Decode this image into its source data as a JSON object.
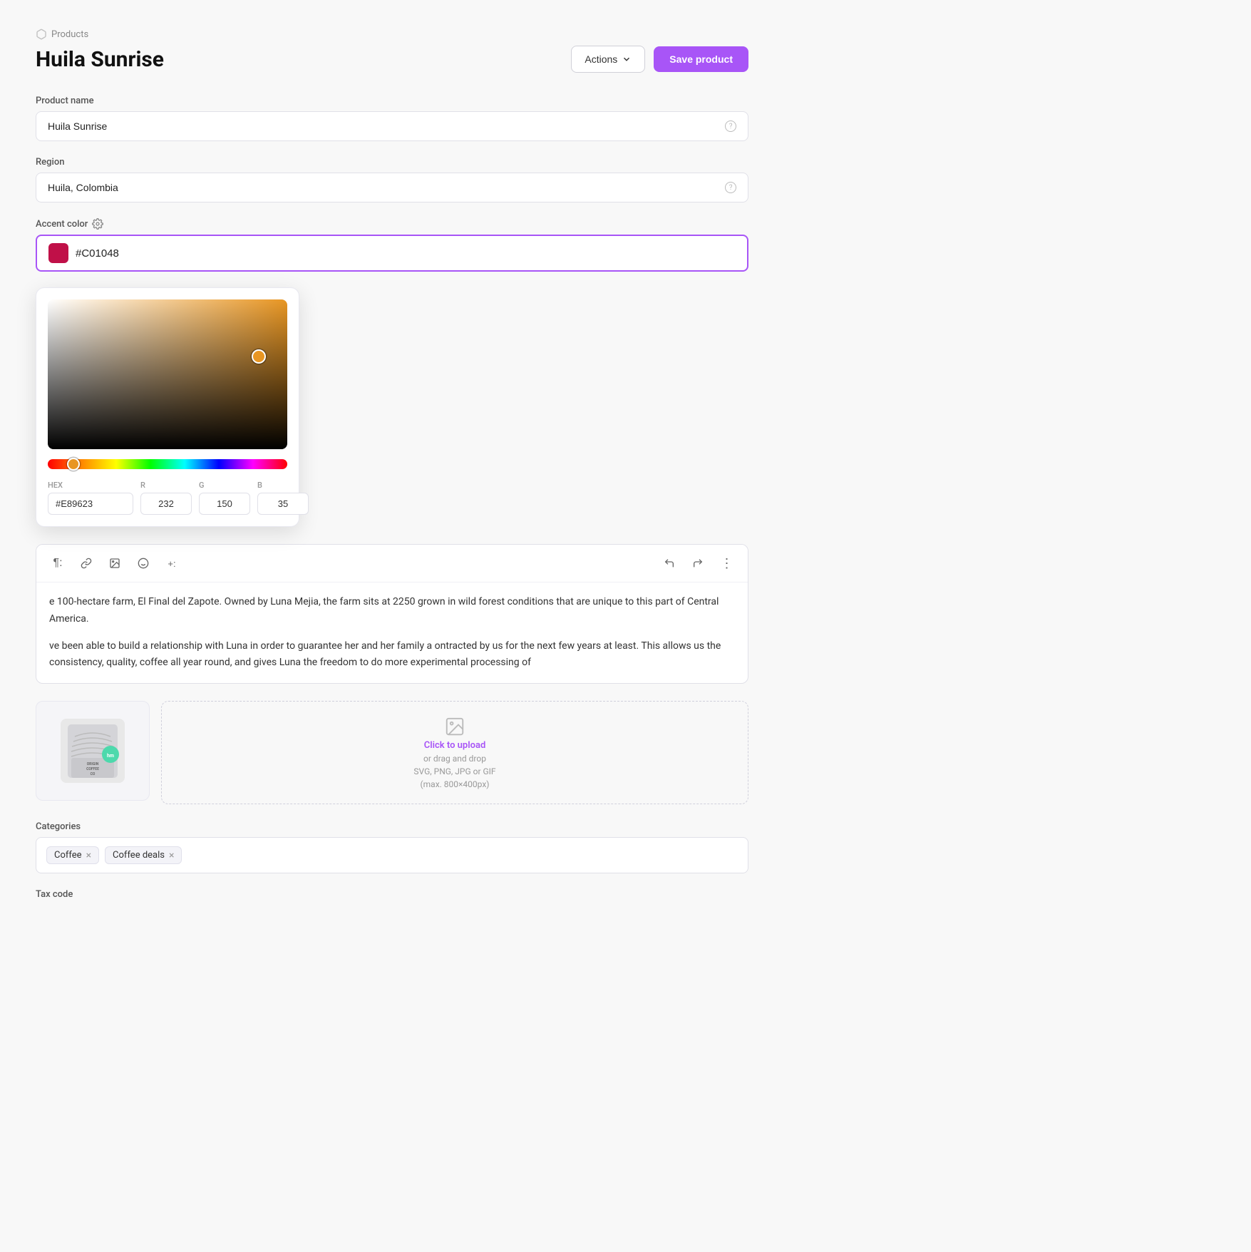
{
  "breadcrumb": {
    "icon": "cube",
    "label": "Products"
  },
  "page": {
    "title": "Huila Sunrise"
  },
  "header": {
    "actions_label": "Actions",
    "save_label": "Save product"
  },
  "form": {
    "product_name_label": "Product name",
    "product_name_value": "Huila Sunrise",
    "region_label": "Region",
    "region_value": "Huila, Colombia",
    "accent_color_label": "Accent color",
    "accent_color_value": "#C01048"
  },
  "color_picker": {
    "hex_label": "HEX",
    "hex_value": "#E89623",
    "r_label": "R",
    "r_value": "232",
    "g_label": "G",
    "g_value": "150",
    "b_label": "B",
    "b_value": "35"
  },
  "editor": {
    "content_1": "e 100-hectare farm, El Final del Zapote. Owned by Luna Mejia, the farm sits at 2250 grown in wild forest conditions that are unique to this part of Central America.",
    "content_2": "ve been able to build a relationship with Luna in order to guarantee her and her family a ontracted by us for the next few years at least. This allows us the consistency, quality, coffee all year round, and gives Luna the freedom to do more experimental processing of"
  },
  "toolbar": {
    "paragraph_icon": "¶",
    "link_icon": "🔗",
    "image_icon": "🖼",
    "emoji_icon": "😊",
    "plus_icon": "+:",
    "undo_icon": "↩",
    "redo_icon": "↪",
    "more_icon": "⋮"
  },
  "upload": {
    "primary_label": "Click to upload",
    "secondary_label": "or drag and drop",
    "format_label": "SVG, PNG, JPG or GIF",
    "size_label": "(max. 800×400px)"
  },
  "categories": {
    "label": "Categories",
    "tags": [
      {
        "id": "coffee",
        "label": "Coffee"
      },
      {
        "id": "coffee-deals",
        "label": "Coffee deals"
      }
    ]
  },
  "tax_code": {
    "label": "Tax code"
  },
  "colors": {
    "accent_purple": "#a855f7",
    "swatch_red": "#C01048"
  }
}
